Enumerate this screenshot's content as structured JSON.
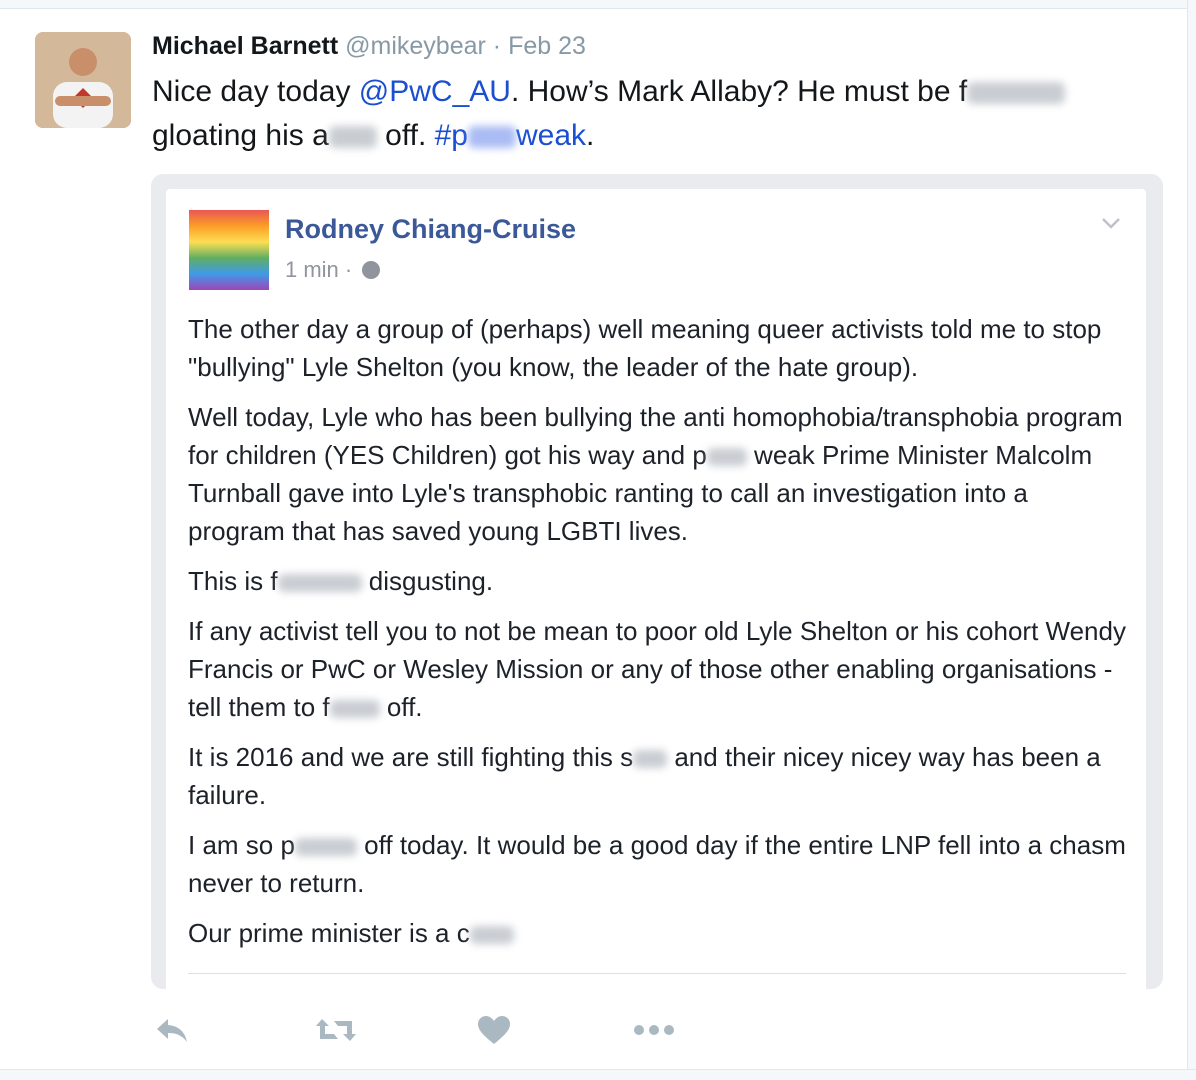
{
  "tweet": {
    "author_name": "Michael Barnett",
    "handle": "@mikeybear",
    "separator": "·",
    "date": "Feb 23",
    "text_1": "Nice day today ",
    "mention": "@PwC_AU",
    "text_2": ". How’s Mark Allaby? He must be f",
    "text_3": "gloating his a",
    "text_4": " off. ",
    "hashtag_1": "#p",
    "hashtag_2": "weak",
    "text_5": "."
  },
  "embedded_post": {
    "author_name": "Rodney Chiang-Cruise",
    "time": "1 min",
    "separator": "·",
    "paragraphs": {
      "p1": "The other day a group of (perhaps) well meaning queer activists told me to stop \"bullying\" Lyle Shelton (you know, the leader of the hate group).",
      "p2a": "Well today, Lyle who has been bullying the anti homophobia/transphobia program for children (YES Children) got his way and p",
      "p2b": " weak Prime Minister Malcolm Turnball gave into Lyle's transphobic ranting to call an investigation into a program that has saved young LGBTI lives.",
      "p3a": "This is f",
      "p3b": " disgusting.",
      "p4a": "If any activist tell you to not be mean to poor old Lyle Shelton or his cohort Wendy Francis or PwC or Wesley Mission or any of those other enabling organisations - tell them to f",
      "p4b": " off.",
      "p5a": "It is 2016 and we are still fighting this s",
      "p5b": " and their nicey nicey way has been a failure.",
      "p6a": "I am so p",
      "p6b": " off today. It would be a good day if the entire LNP fell into a chasm never to return.",
      "p7a": "Our prime minister is a c"
    }
  },
  "actions": [
    "reply-icon",
    "retweet-icon",
    "like-icon",
    "more-icon"
  ],
  "colors": {
    "link": "#1b4fd1",
    "fb_name": "#3b5998",
    "muted": "#8899a6",
    "action_icon": "#aab8c2"
  }
}
